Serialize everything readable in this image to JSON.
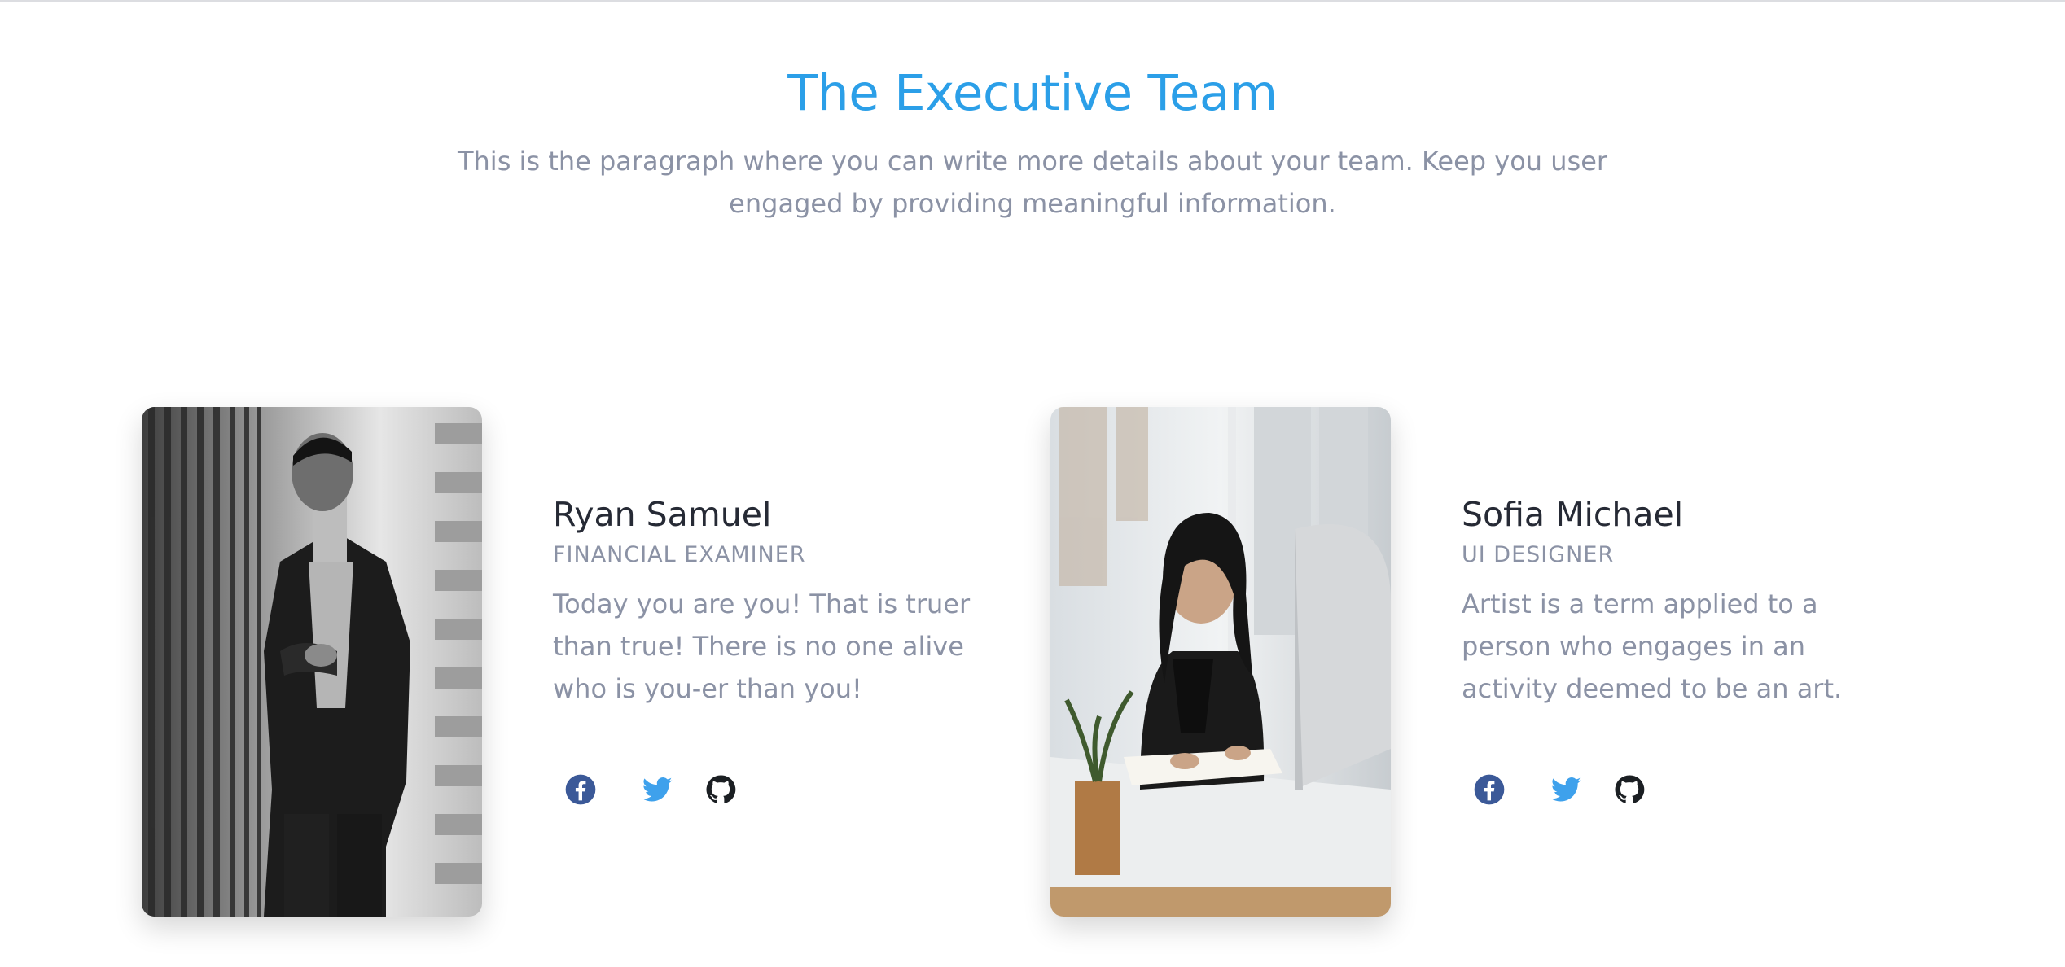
{
  "header": {
    "title": "The Executive Team",
    "subtitle": "This is the paragraph where you can write more details about your team. Keep you user engaged by providing meaningful information."
  },
  "team": [
    {
      "name": "Ryan Samuel",
      "role": "FINANCIAL EXAMINER",
      "bio": "Today you are you! That is truer than true! There is no one alive who is you-er than you!",
      "photo_icon": "man-in-suit-photo",
      "socials": [
        "facebook-icon",
        "twitter-icon",
        "github-icon"
      ]
    },
    {
      "name": "Sofia Michael",
      "role": "UI DESIGNER",
      "bio": "Artist is a term applied to a person who engages in an activity deemed to be an art.",
      "photo_icon": "woman-at-desk-photo",
      "socials": [
        "facebook-icon",
        "twitter-icon",
        "github-icon"
      ]
    }
  ],
  "colors": {
    "accent": "#2b9fe8",
    "name_text": "#262a35",
    "muted_text": "#8b92a5",
    "facebook": "#3b5998",
    "twitter": "#3ea1ec",
    "github": "#1b1f23"
  }
}
